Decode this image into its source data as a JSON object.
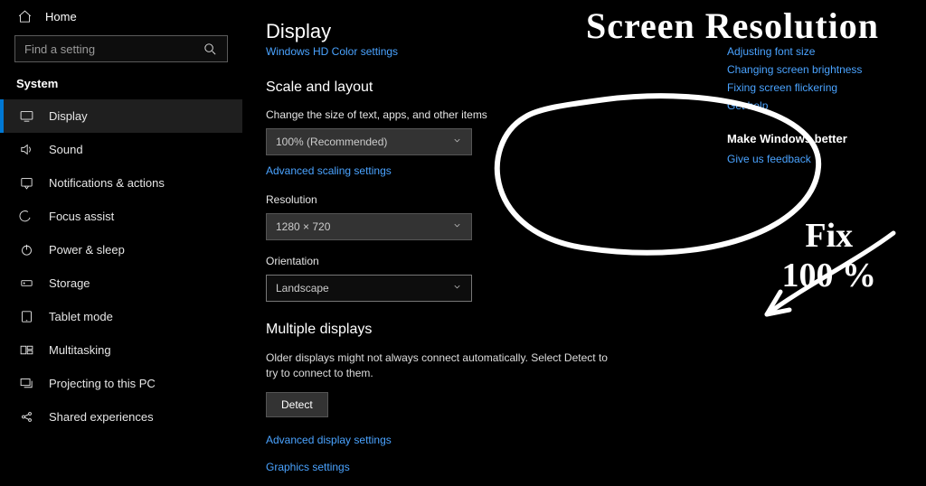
{
  "sidebar": {
    "home": "Home",
    "searchPlaceholder": "Find a setting",
    "sectionTitle": "System",
    "items": [
      {
        "label": "Display"
      },
      {
        "label": "Sound"
      },
      {
        "label": "Notifications & actions"
      },
      {
        "label": "Focus assist"
      },
      {
        "label": "Power & sleep"
      },
      {
        "label": "Storage"
      },
      {
        "label": "Tablet mode"
      },
      {
        "label": "Multitasking"
      },
      {
        "label": "Projecting to this PC"
      },
      {
        "label": "Shared experiences"
      }
    ]
  },
  "main": {
    "pageTitle": "Display",
    "hdLink": "Windows HD Color settings",
    "scaleHeading": "Scale and layout",
    "scaleLabel": "Change the size of text, apps, and other items",
    "scaleValue": "100% (Recommended)",
    "advScaleLink": "Advanced scaling settings",
    "resLabel": "Resolution",
    "resValue": "1280 × 720",
    "orientLabel": "Orientation",
    "orientValue": "Landscape",
    "multiHeading": "Multiple displays",
    "multiPara": "Older displays might not always connect automatically. Select Detect to try to connect to them.",
    "detectBtn": "Detect",
    "advDispLink": "Advanced display settings",
    "gfxLink": "Graphics settings"
  },
  "right": {
    "links": [
      "Adjusting font size",
      "Changing screen brightness",
      "Fixing screen flickering",
      "Get help"
    ],
    "betterHeading": "Make Windows better",
    "feedbackLink": "Give us feedback"
  },
  "overlay": {
    "title": "Screen Resolution",
    "fix1": "Fix",
    "fix2": "100 %"
  }
}
